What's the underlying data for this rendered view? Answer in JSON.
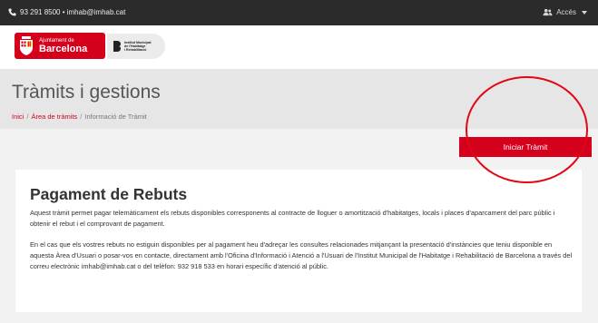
{
  "topbar": {
    "contact": "93 291 8500 • imhab@imhab.cat",
    "access_label": "Accés",
    "icons": {
      "phone": "phone-icon",
      "users": "users-icon",
      "caret": "caret-down-icon"
    }
  },
  "header": {
    "logo_small": "Ajuntament de",
    "logo_big": "Barcelona",
    "imhab_lines": [
      "Institut Municipal",
      "de l'Habitatge",
      "i Rehabilitació"
    ]
  },
  "page": {
    "title": "Tràmits i gestions",
    "breadcrumb": [
      "Inici",
      "Àrea de tràmits",
      "Informació de Tràmit"
    ],
    "breadcrumb_sep": "/"
  },
  "action": {
    "start_label": "Iniciar Tràmit"
  },
  "content": {
    "heading": "Pagament de Rebuts",
    "paragraph1": "Aquest tràmit permet pagar telemàticament els rebuts disponibles corresponents al contracte de lloguer o amortització d'habitatges, locals i places d'aparcament del parc públic i obtenir el rebut i el comprovant de pagament.",
    "paragraph2": "En el cas que els vostres rebuts no estiguin disponibles per al pagament heu d'adreçar les consultes relacionades mitjançant la presentació d'instàncies que teniu disponible en aquesta Àrea d'Usuari o posar-vos en contacte, directament amb l'Oficina d'Informació i Atenció a l'Usuari de l'Institut Municipal de l'Habitatge i Rehabilitació de Barcelona a través del correu electrònic imhab@imhab.cat o del telèfon: 932 918 533 en horari específic d'atenció al públic."
  },
  "colors": {
    "brand_red": "#d5001c",
    "topbar": "#2b2b2b",
    "annotation": "#e30613"
  }
}
